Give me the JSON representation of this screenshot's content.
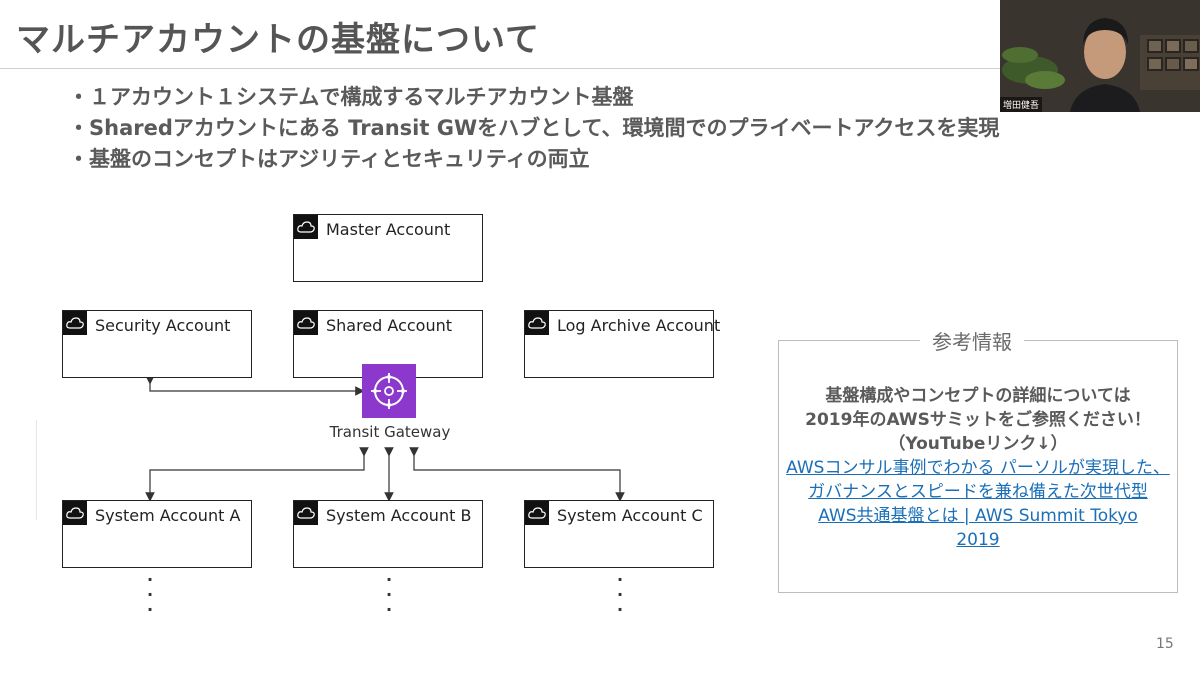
{
  "slide": {
    "title": "マルチアカウントの基盤について",
    "bullets": [
      "・１アカウント１システムで構成するマルチアカウント基盤",
      "・Sharedアカウントにある Transit GWをハブとして、環境間でのプライベートアクセスを実現",
      "・基盤のコンセプトはアジリティとセキュリティの両立"
    ],
    "page_number": "15"
  },
  "diagram": {
    "master": "Master Account",
    "security": "Security Account",
    "shared": "Shared Account",
    "log_archive": "Log Archive Account",
    "transit_gateway": "Transit Gateway",
    "system_a": "System Account A",
    "system_b": "System Account B",
    "system_c": "System Account C",
    "icon": "cloud-icon",
    "tgw_color": "#8c38cc"
  },
  "reference": {
    "title": "参考情報",
    "lines": [
      "基盤構成やコンセプトの詳細については",
      "2019年のAWSサミットをご参照ください！",
      "（YouTubeリンク↓）"
    ],
    "link_lines": [
      "AWSコンサル事例でわかる パーソルが実現した、",
      "ガバナンスとスピードを兼ね備えた次世代型",
      "AWS共通基盤とは | AWS Summit Tokyo",
      "2019"
    ]
  },
  "webcam": {
    "name": "増田健吾"
  }
}
